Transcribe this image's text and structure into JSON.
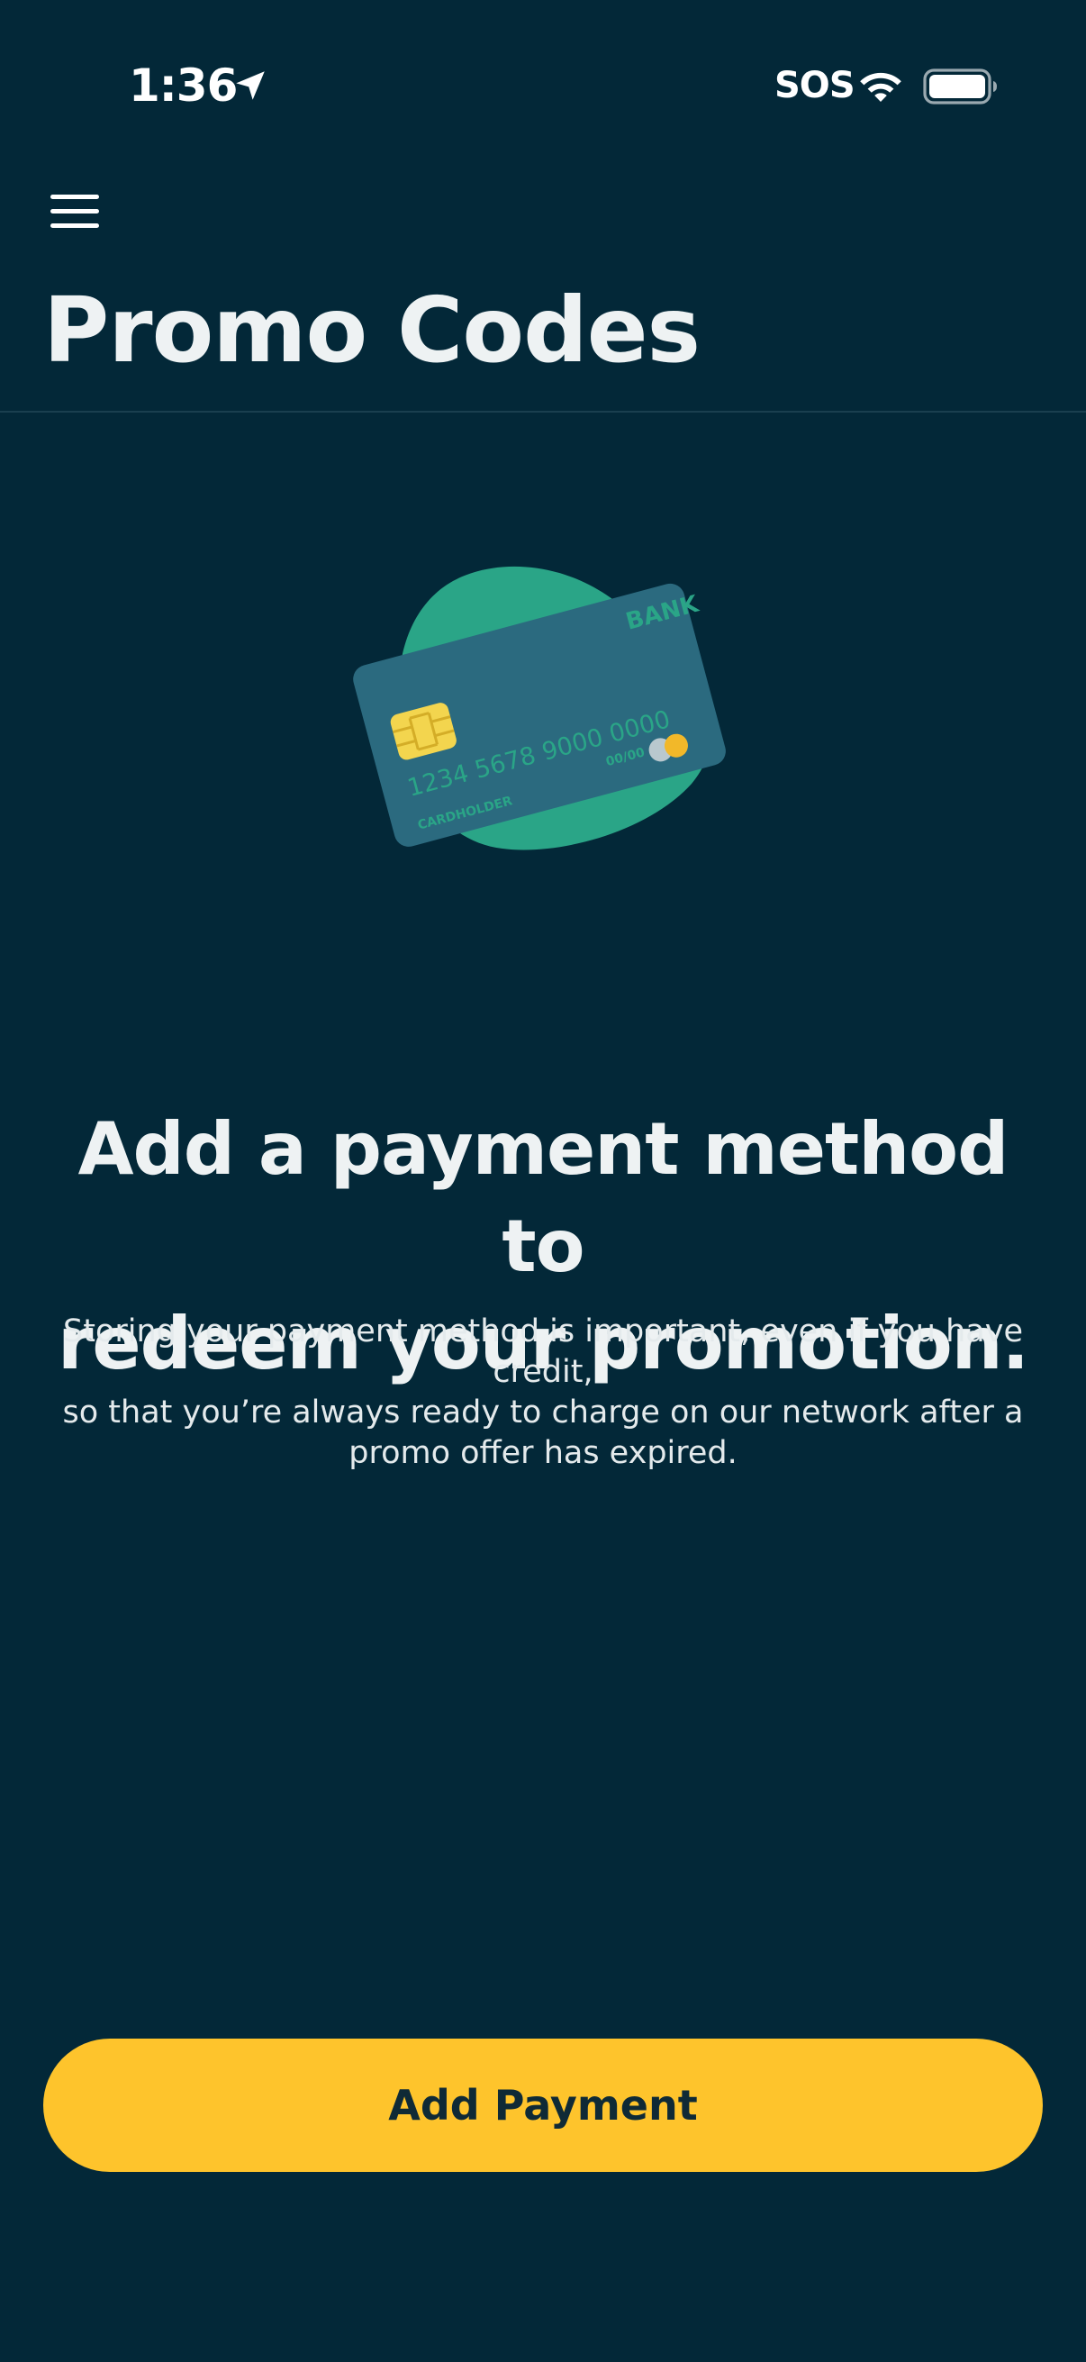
{
  "status_bar": {
    "time": "1:36",
    "carrier_status": "SOS",
    "icons": [
      "location-arrow-icon",
      "wifi-icon",
      "battery-icon"
    ]
  },
  "header": {
    "menu_icon": "hamburger-menu-icon",
    "title": "Promo Codes"
  },
  "illustration": {
    "card_bank": "BANK",
    "card_number": "1234  5678  9000  0000",
    "card_expiry": "00/00",
    "card_holder": "CARDHOLDER"
  },
  "main": {
    "headline_line1": "Add a payment method to",
    "headline_line2": "redeem your promotion.",
    "body_line1": "Storing your payment method is important, even if you have credit,",
    "body_line2": "so that you’re always ready to charge on our network after a",
    "body_line3": "promo offer has expired."
  },
  "actions": {
    "add_payment_label": "Add Payment"
  },
  "colors": {
    "background": "#032838",
    "accent": "#fec42c",
    "card": "#2b6a7f",
    "card_blob": "#2aa587",
    "chip": "#f3d54e"
  }
}
